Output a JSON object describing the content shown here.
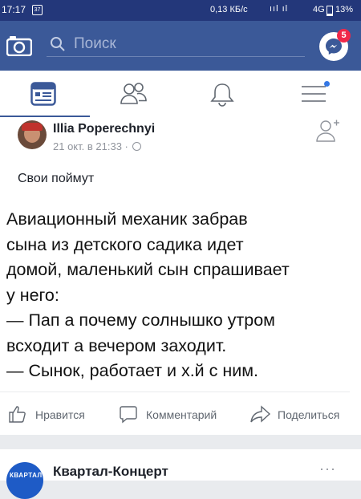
{
  "status_bar": {
    "time": "17:17",
    "notification": "37",
    "speed": "0,13 КБ/с",
    "signal": "ııl ıl",
    "network": "4G",
    "battery": "13%"
  },
  "top_bar": {
    "search_placeholder": "Поиск",
    "messenger_badge": "5",
    "colors": {
      "brand": "#3b5998",
      "badge": "#f02849"
    }
  },
  "tabs": [
    "news-feed",
    "friends",
    "notifications",
    "menu"
  ],
  "post": {
    "author": "Illia Poperechnyi",
    "timestamp": "21 окт. в 21:33 · ",
    "text": "Свои поймут",
    "image_text": "Авиационный механик забрав\nсына из детского садика идет\nдомой, маленький сын спрашивает\nу него:\n— Пап а почему солнышко утром\nвсходит а вечером заходит.\n— Сынок, работает и х.й с ним.",
    "actions": {
      "like": "Нравится",
      "comment": "Комментарий",
      "share": "Поделиться"
    }
  },
  "next_post": {
    "page_name": "Квартал-Концерт",
    "avatar_text": "КВАРТАЛ",
    "more": "···"
  }
}
